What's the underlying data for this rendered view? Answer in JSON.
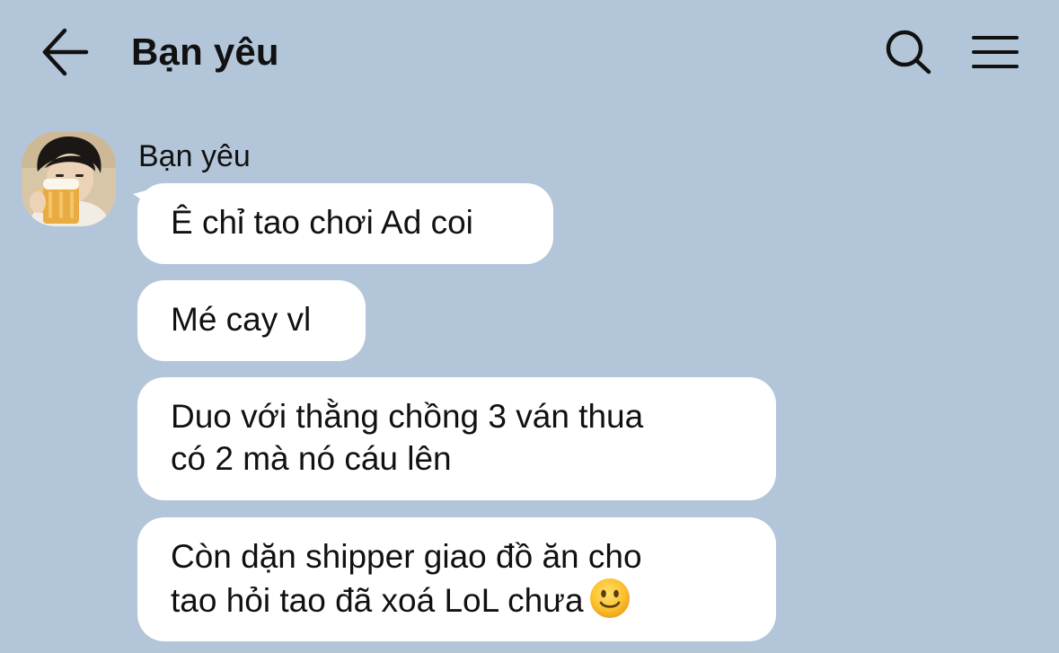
{
  "header": {
    "title": "Bạn yêu",
    "back_icon": "arrow-left-icon",
    "search_icon": "search-icon",
    "menu_icon": "hamburger-menu-icon"
  },
  "chat": {
    "sender": {
      "name": "Bạn yêu",
      "avatar_icon": "user-avatar-photo"
    },
    "messages": [
      {
        "lines": [
          "Ê chỉ tao chơi Ad coi"
        ]
      },
      {
        "lines": [
          "Mé cay vl"
        ]
      },
      {
        "lines": [
          "Duo với thằng chồng 3 ván thua",
          "có 2 mà nó cáu lên"
        ]
      },
      {
        "lines": [
          "Còn dặn shipper giao đồ ăn cho",
          "tao hỏi tao đã xoá LoL chưa"
        ],
        "emoji": "slightly-smiling-face"
      }
    ]
  },
  "colors": {
    "background": "#b3c5d8",
    "bubble": "#ffffff",
    "text": "#111111"
  }
}
